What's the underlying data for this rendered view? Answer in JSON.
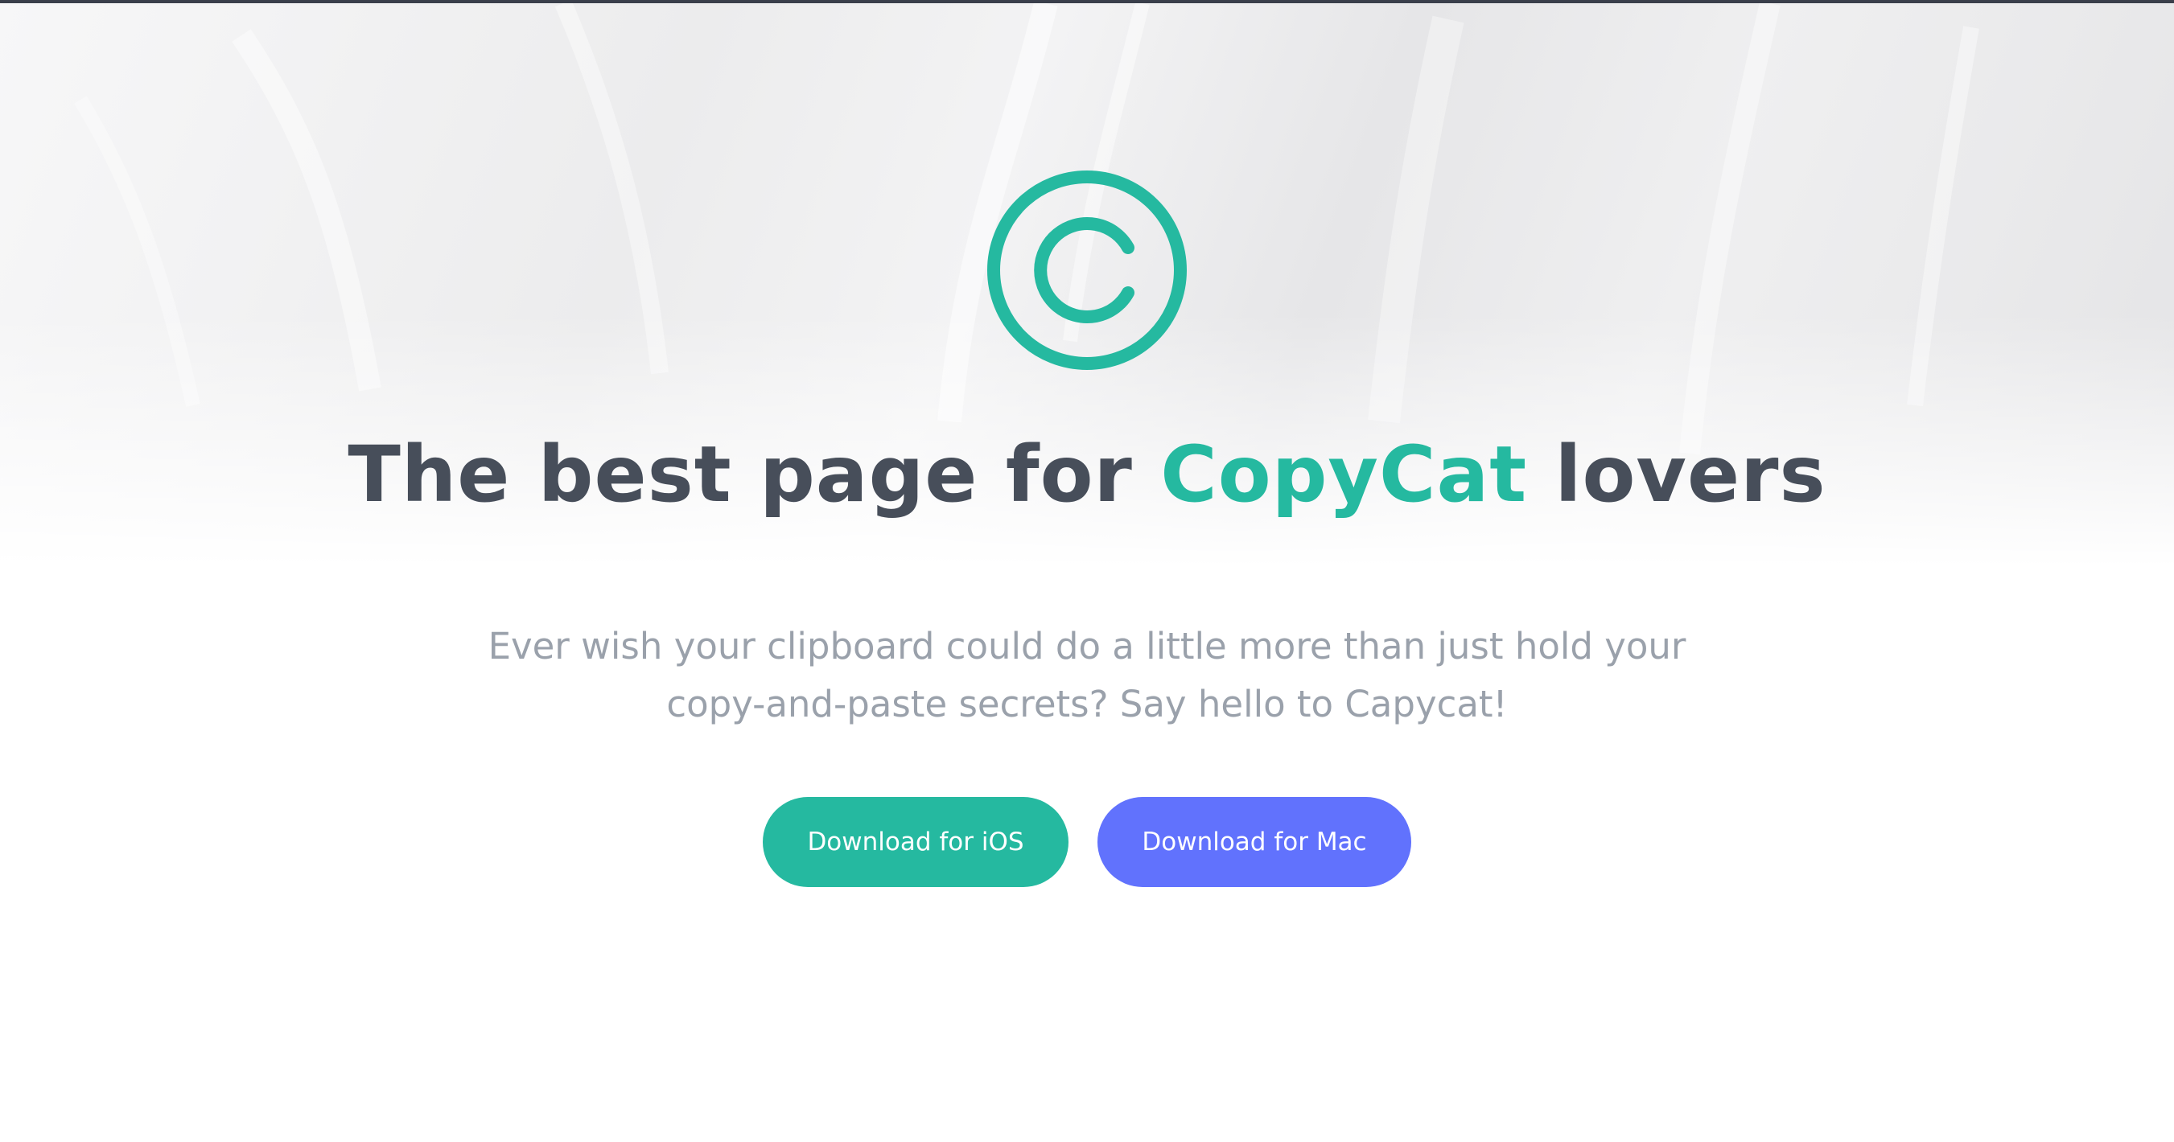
{
  "hero": {
    "logo_icon": "copyright-icon",
    "title_prefix": "The best page for ",
    "title_accent": "CopyCat",
    "title_suffix": " lovers",
    "subtitle_line1": "Ever wish your clipboard could do a little more than just hold your",
    "subtitle_line2": "copy-and-paste secrets? Say hello to Capycat!"
  },
  "buttons": {
    "ios_label": "Download for iOS",
    "mac_label": "Download for Mac"
  },
  "colors": {
    "accent": "#25b9a0",
    "secondary": "#6172fd",
    "heading": "#474e5a",
    "body_text": "#9aa1ab"
  }
}
